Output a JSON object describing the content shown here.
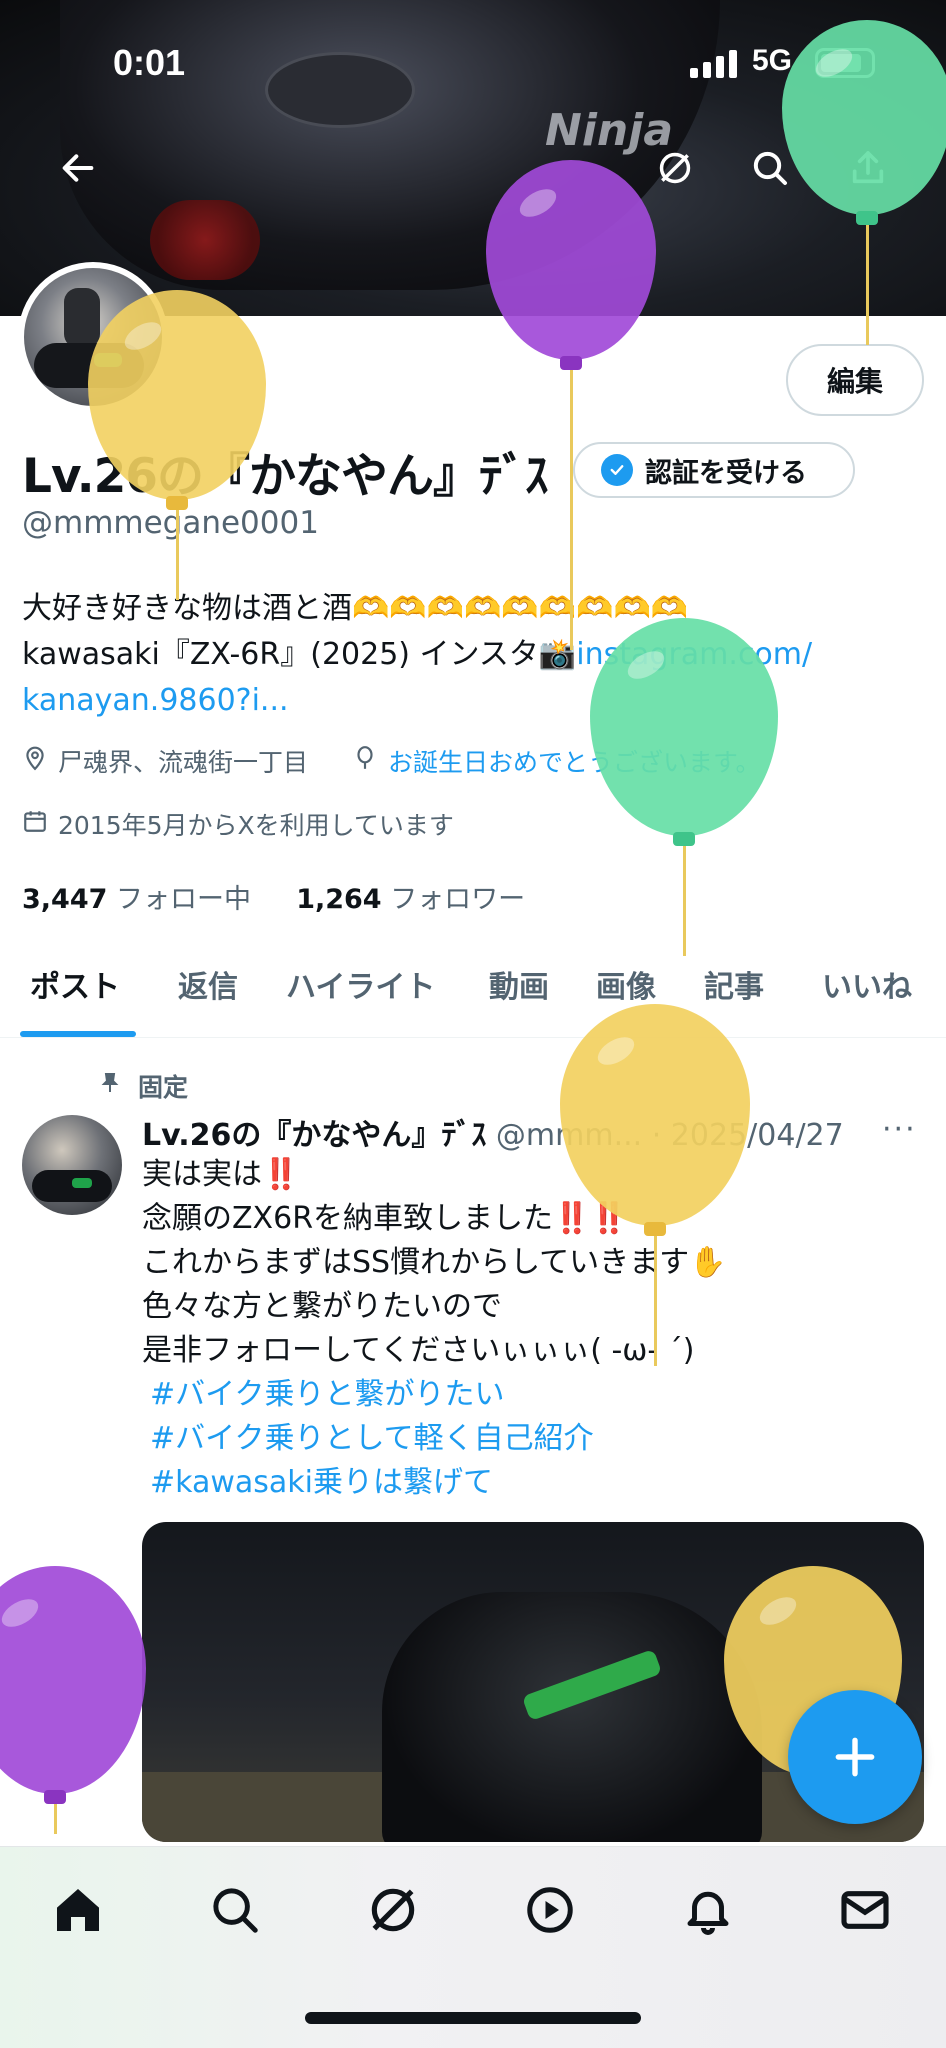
{
  "status_bar": {
    "time": "0:01",
    "network": "5G"
  },
  "profile": {
    "edit_label": "編集",
    "display_name": "Lv.26の『かなやん』ﾃﾞｽ",
    "verify_label": "認証を受ける",
    "handle": "@mmmegane0001",
    "bio_line1": "大好き好きな物は酒と酒🫶🫶🫶🫶🫶🫶🫶🫶🫶",
    "bio_line2": "kawasaki『ZX-6R』(2025) インスタ📸",
    "bio_link_part1": "instagram.com/",
    "bio_link_part2": "kanayan.9860?i...",
    "location": "尸魂界、流魂街一丁目",
    "birthday": "お誕生日おめでとうございます。",
    "joined": "2015年5月からXを利用しています",
    "following_count": "3,447",
    "following_label": "フォロー中",
    "followers_count": "1,264",
    "followers_label": "フォロワー"
  },
  "tabs": [
    "ポスト",
    "返信",
    "ハイライト",
    "動画",
    "画像",
    "記事",
    "いいね"
  ],
  "tweet": {
    "pinned_label": "固定",
    "name": "Lv.26の『かなやん』ﾃﾞｽ",
    "handle_date": "@mmm... · 2025/04/27",
    "more": "···",
    "lines": [
      "実は実は‼️",
      "念願のZX6Rを納車致しました‼️‼️",
      "これからまずはSS慣れからしていきます✋",
      "色々な方と繋がりたいので",
      "是非フォローしてくださいぃぃぃ( -ω- ´)"
    ],
    "hashtags": [
      "#バイク乗りと繋がりたい",
      "#バイク乗りとして軽く自己紹介",
      "#kawasaki乗りは繋げて"
    ]
  },
  "colors": {
    "accent": "#1d9bf0",
    "balloon_yellow": "#f2d060",
    "balloon_green": "#66dea6",
    "balloon_purple": "#a14ad8"
  },
  "icons": [
    "back-arrow-icon",
    "grok-icon",
    "search-icon",
    "share-icon",
    "location-icon",
    "balloon-icon",
    "calendar-icon",
    "pin-icon",
    "compose-plus-icon",
    "home-icon",
    "explore-icon",
    "grok-nav-icon",
    "video-icon",
    "notifications-icon",
    "messages-icon"
  ]
}
